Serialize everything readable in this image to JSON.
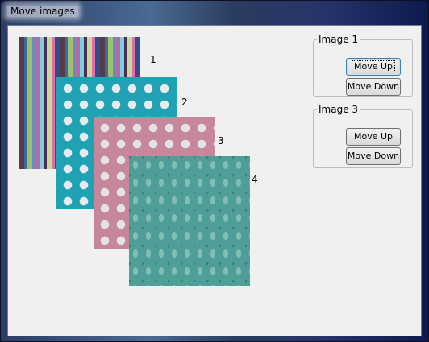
{
  "window": {
    "title": "Move images"
  },
  "images": [
    {
      "number": "1",
      "pattern": "stripes"
    },
    {
      "number": "2",
      "pattern": "polka-dots-teal"
    },
    {
      "number": "3",
      "pattern": "polka-dots-pink"
    },
    {
      "number": "4",
      "pattern": "damask-teal"
    }
  ],
  "groups": [
    {
      "legend": "Image 1",
      "move_up": "Move Up",
      "move_down": "Move Down"
    },
    {
      "legend": "Image 3",
      "move_up": "Move Up",
      "move_down": "Move Down"
    }
  ]
}
